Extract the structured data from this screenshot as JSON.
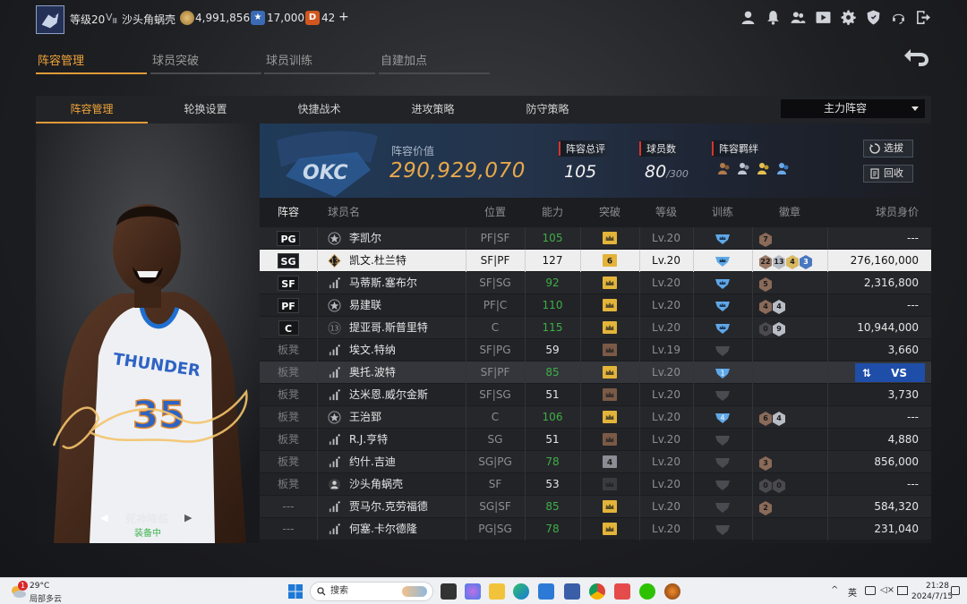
{
  "top_bar": {
    "level": "等级20",
    "rank": "Ⅲ",
    "username": "沙头角蜗壳",
    "coins": "4,991,856",
    "stars": "17,000",
    "tickets": "42",
    "plus": "+",
    "icons": [
      "profile-icon",
      "bell-icon",
      "friends-icon",
      "video-icon",
      "settings-icon",
      "shield-icon",
      "headset-icon",
      "exit-icon"
    ]
  },
  "main_tabs": [
    {
      "label": "阵容管理",
      "active": true
    },
    {
      "label": "球员突破",
      "active": false
    },
    {
      "label": "球员训练",
      "active": false
    },
    {
      "label": "自建加点",
      "active": false
    }
  ],
  "sub_tabs": [
    {
      "label": "阵容管理",
      "active": true
    },
    {
      "label": "轮换设置",
      "active": false
    },
    {
      "label": "快捷战术",
      "active": false
    },
    {
      "label": "进攻策略",
      "active": false
    },
    {
      "label": "防守策略",
      "active": false
    }
  ],
  "lineup_select": "主力阵容",
  "player_card": {
    "skill_name": "死神降临",
    "skill_status": "装备中",
    "prev": "◀",
    "next": "▶",
    "jersey_team": "THUNDER",
    "jersey_number": "35"
  },
  "summary": {
    "team_logo": "OKC",
    "value_label": "阵容价值",
    "value": "290,929,070",
    "rating_label": "阵容总评",
    "rating": "105",
    "count_label": "球员数",
    "count": "80",
    "count_max": "/300",
    "bond_label": "阵容羁绊",
    "buttons": {
      "select": "选拔",
      "recycle": "回收"
    }
  },
  "table": {
    "headers": [
      "阵容",
      "球员名",
      "位置",
      "能力",
      "突破",
      "等级",
      "训练",
      "徽章",
      "球员身价"
    ],
    "rows": [
      {
        "slot": "PG",
        "starter": true,
        "icon": "star-icon",
        "name": "李凯尔",
        "pos": "PF|SF",
        "ability": "105",
        "ability_color": "green",
        "break": "crown-gold",
        "level": "Lv.20",
        "train": "blue",
        "badges": [
          {
            "t": "7",
            "c": "#8a6a58"
          }
        ],
        "price": "---"
      },
      {
        "slot": "SG",
        "starter": true,
        "icon": "crest-icon",
        "icon_text": "13",
        "name": "凯文.杜兰特",
        "pos": "SF|PF",
        "ability": "127",
        "ability_color": "white",
        "break": "6",
        "level": "Lv.20",
        "train": "blue",
        "badges": [
          {
            "t": "22",
            "c": "#9a7a66"
          },
          {
            "t": "13",
            "c": "#b8bcc4"
          },
          {
            "t": "4",
            "c": "#d8b860"
          },
          {
            "t": "3",
            "c": "#4a78c0"
          }
        ],
        "price": "276,160,000",
        "selected": true
      },
      {
        "slot": "SF",
        "starter": true,
        "icon": "bars-icon",
        "name": "马蒂斯.塞布尔",
        "pos": "SF|SG",
        "ability": "92",
        "ability_color": "green",
        "break": "crown-gold",
        "level": "Lv.20",
        "train": "blue",
        "badges": [
          {
            "t": "5",
            "c": "#8a6a58"
          }
        ],
        "price": "2,316,800"
      },
      {
        "slot": "PF",
        "starter": true,
        "icon": "star-icon",
        "name": "易建联",
        "pos": "PF|C",
        "ability": "110",
        "ability_color": "green",
        "break": "crown-gold",
        "level": "Lv.20",
        "train": "blue",
        "badges": [
          {
            "t": "4",
            "c": "#8a6a58"
          },
          {
            "t": "4",
            "c": "#b8bcc4"
          }
        ],
        "price": "---"
      },
      {
        "slot": "C",
        "starter": true,
        "icon": "circle-icon",
        "icon_text": "13",
        "name": "提亚哥.斯普里特",
        "pos": "C",
        "ability": "115",
        "ability_color": "green",
        "break": "crown-gold",
        "level": "Lv.20",
        "train": "blue",
        "badges": [
          {
            "t": "0",
            "c": "#4a4a4e"
          },
          {
            "t": "9",
            "c": "#b8bcc4"
          }
        ],
        "price": "10,944,000"
      },
      {
        "slot": "板凳",
        "starter": false,
        "icon": "bars-icon",
        "name": "埃文.特纳",
        "pos": "SF|PG",
        "ability": "59",
        "ability_color": "white",
        "break": "crown-brown",
        "level": "Lv.19",
        "train": "grey",
        "badges": [],
        "price": "3,660"
      },
      {
        "slot": "板凳",
        "starter": false,
        "icon": "bars-icon",
        "name": "奥托.波特",
        "pos": "SF|PF",
        "ability": "85",
        "ability_color": "green",
        "break": "crown-gold",
        "level": "Lv.20",
        "train": "blue1",
        "badges": [],
        "price": "",
        "highlight": true
      },
      {
        "slot": "板凳",
        "starter": false,
        "icon": "bars-icon",
        "name": "达米恩.威尔金斯",
        "pos": "SF|SG",
        "ability": "51",
        "ability_color": "white",
        "break": "crown-brown",
        "level": "Lv.20",
        "train": "grey",
        "badges": [],
        "price": "3,730"
      },
      {
        "slot": "板凳",
        "starter": false,
        "icon": "star-icon",
        "name": "王治郅",
        "pos": "C",
        "ability": "106",
        "ability_color": "green",
        "break": "crown-gold",
        "level": "Lv.20",
        "train": "blue4",
        "badges": [
          {
            "t": "6",
            "c": "#8a6a58"
          },
          {
            "t": "4",
            "c": "#b8bcc4"
          }
        ],
        "price": "---"
      },
      {
        "slot": "板凳",
        "starter": false,
        "icon": "bars-icon",
        "name": "R.J.亨特",
        "pos": "SG",
        "ability": "51",
        "ability_color": "white",
        "break": "crown-brown",
        "level": "Lv.20",
        "train": "grey",
        "badges": [],
        "price": "4,880"
      },
      {
        "slot": "板凳",
        "starter": false,
        "icon": "bars-icon",
        "name": "约什.吉迪",
        "pos": "SG|PG",
        "ability": "78",
        "ability_color": "green",
        "break": "4",
        "level": "Lv.20",
        "train": "grey",
        "badges": [
          {
            "t": "3",
            "c": "#8a6a58"
          }
        ],
        "price": "856,000"
      },
      {
        "slot": "板凳",
        "starter": false,
        "icon": "person-icon",
        "name": "沙头角蜗壳",
        "pos": "SF",
        "ability": "53",
        "ability_color": "white",
        "break": "crown-dark",
        "level": "Lv.20",
        "train": "grey",
        "badges": [
          {
            "t": "0",
            "c": "#4a4a4e"
          },
          {
            "t": "0",
            "c": "#4a4a4e"
          }
        ],
        "price": "---"
      },
      {
        "slot": "---",
        "starter": false,
        "icon": "bars-icon",
        "name": "贾马尔.克劳福德",
        "pos": "SG|SF",
        "ability": "85",
        "ability_color": "green",
        "break": "crown-gold",
        "level": "Lv.20",
        "train": "grey",
        "badges": [
          {
            "t": "2",
            "c": "#8a6a58"
          }
        ],
        "price": "584,320"
      },
      {
        "slot": "---",
        "starter": false,
        "icon": "bars-icon",
        "name": "何塞.卡尔德隆",
        "pos": "PG|SG",
        "ability": "78",
        "ability_color": "green",
        "break": "crown-gold",
        "level": "Lv.20",
        "train": "grey",
        "badges": [],
        "price": "231,040"
      }
    ],
    "swap_vs": "VS"
  },
  "taskbar": {
    "weather_temp": "29°C",
    "weather_desc": "局部多云",
    "weather_badge": "1",
    "search": "搜索",
    "ime": "英",
    "time": "21:28",
    "date": "2024/7/15"
  }
}
